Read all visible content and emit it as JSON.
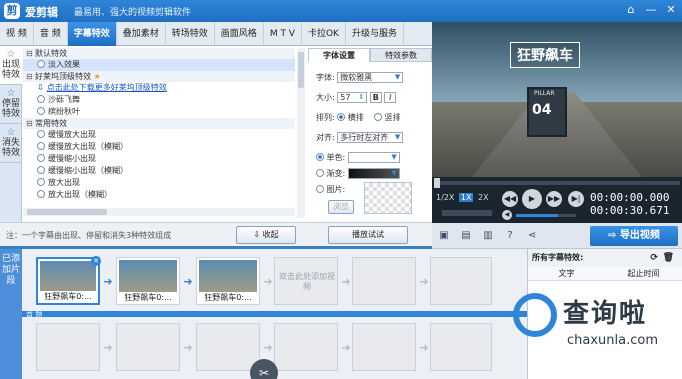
{
  "window": {
    "app_name": "爱剪辑",
    "slogan": "最易用、强大的视频剪辑软件",
    "controls": [
      "⌂",
      "—",
      "✕"
    ]
  },
  "menu": {
    "tabs": [
      {
        "label": "视  频",
        "active": false
      },
      {
        "label": "音  频",
        "active": false
      },
      {
        "label": "字幕特效",
        "active": true
      },
      {
        "label": "叠加素材",
        "active": false
      },
      {
        "label": "转场特效",
        "active": false
      },
      {
        "label": "画面风格",
        "active": false
      },
      {
        "label": "M T V",
        "active": false
      },
      {
        "label": "卡拉OK",
        "active": false
      },
      {
        "label": "升级与服务",
        "active": false
      }
    ]
  },
  "side_tabs": [
    "出现特效",
    "停留特效",
    "消失特效"
  ],
  "effects": {
    "groups": [
      {
        "title": "默认特效",
        "items": [
          "淡入效果"
        ]
      },
      {
        "title": "好莱坞顶级特效",
        "download_link": "点击此处下载更多好莱坞顶级特效",
        "items": [
          "沙砾飞舞",
          "缤纷秋叶"
        ]
      },
      {
        "title": "常用特效",
        "items": [
          "缓慢放大出现",
          "缓慢放大出现（模糊）",
          "缓慢缩小出现",
          "缓慢缩小出现（模糊）",
          "放大出现",
          "放大出现（模糊）"
        ]
      }
    ]
  },
  "properties": {
    "tabs": [
      "字体设置",
      "特效参数"
    ],
    "font_label": "字体:",
    "font_value": "微软雅黑",
    "size_label": "大小:",
    "size_value": "57",
    "bold": "B",
    "italic": "I",
    "layout_label": "排列:",
    "layout_horizontal": "横排",
    "layout_vertical": "竖排",
    "align_label": "对齐:",
    "align_value": "多行时左对齐",
    "solid_label": "单色:",
    "gradient_label": "渐变:",
    "image_label": "图片:",
    "browse": "浏览"
  },
  "footer": {
    "note": "注：一个字幕由出现、停留和消失3种特效组成",
    "collapse": "收起",
    "preview": "播放试试"
  },
  "preview_video": {
    "caption": "狂野飙车",
    "sign_text": "PILLAR",
    "sign_number": "04"
  },
  "player": {
    "speeds": [
      "1/2X",
      "1X",
      "2X"
    ],
    "current_time": "00:00:00.000",
    "total_time": "00:00:30.671"
  },
  "toolbar": {
    "export": "导出视频"
  },
  "timeline": {
    "label": "已添加片段",
    "clips": [
      "狂野飙车0:...",
      "狂野飙车0:...",
      "狂野飙车0:..."
    ],
    "empty_hint": "双击此处添加视频",
    "audio_label": "音  频"
  },
  "subtitle_list": {
    "title": "所有字幕特效:",
    "col_text": "文字",
    "col_time": "起止时间"
  },
  "watermark": {
    "text": "查询啦",
    "url": "chaxunla.com"
  }
}
